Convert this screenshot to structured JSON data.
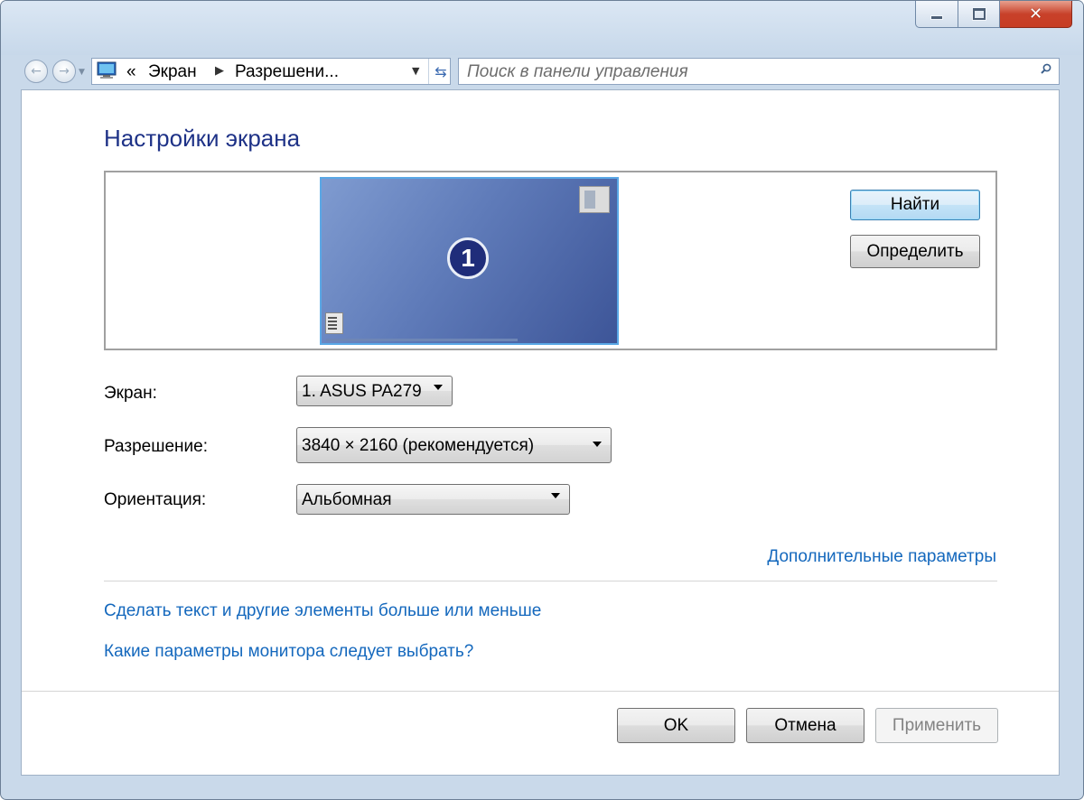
{
  "window": {
    "caption_buttons": {
      "minimize": "minimize-icon",
      "maximize": "maximize-icon",
      "close": "close-icon",
      "close_glyph": "✕"
    }
  },
  "navigation": {
    "back_icon": "back-arrow-icon",
    "forward_icon": "forward-arrow-icon",
    "breadcrumb": {
      "prefix": "«",
      "items": [
        "Экран",
        "Разрешени..."
      ]
    },
    "search_placeholder": "Поиск в панели управления"
  },
  "page": {
    "title": "Настройки экрана",
    "preview": {
      "monitor_number": "1"
    },
    "buttons": {
      "find": "Найти",
      "identify": "Определить"
    },
    "fields": {
      "display": {
        "label": "Экран:",
        "value": "1. ASUS PA279"
      },
      "resolution": {
        "label": "Разрешение:",
        "value": "3840 × 2160 (рекомендуется)"
      },
      "orientation": {
        "label": "Ориентация:",
        "value": "Альбомная"
      }
    },
    "advanced_link": "Дополнительные параметры",
    "links": [
      "Сделать текст и другие элементы больше или меньше",
      "Какие параметры монитора следует выбрать?"
    ]
  },
  "footer": {
    "ok": "OK",
    "cancel": "Отмена",
    "apply": "Применить",
    "apply_enabled": false
  },
  "colors": {
    "title": "#1e3287",
    "link": "#1468bd",
    "frame": "#c9d9ea",
    "close_button": "#c8412a"
  }
}
